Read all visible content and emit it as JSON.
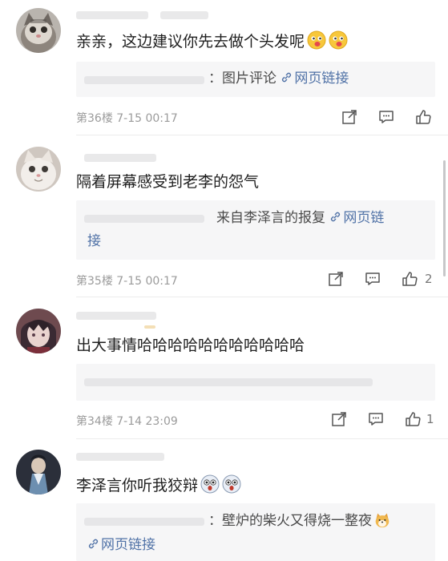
{
  "comments": [
    {
      "text": "亲亲，这边建议你先去做个头发呢",
      "quote": {
        "line1": "：图片评论",
        "link": "网页链接"
      },
      "meta": "第36楼 7-15 00:17",
      "likes": ""
    },
    {
      "text": "隔着屏幕感受到老李的怨气",
      "quote": {
        "line1": "来自李泽言的报复",
        "link_part1": "网页链",
        "link_part2": "接"
      },
      "meta": "第35楼 7-15 00:17",
      "likes": "2"
    },
    {
      "text": "出大事情哈哈哈哈哈哈哈哈哈哈哈",
      "meta": "第34楼 7-14 23:09",
      "likes": "1"
    },
    {
      "text": "李泽言你听我狡辩",
      "quote": {
        "line1": "：壁炉的柴火又得烧一整夜",
        "link": "网页链接"
      }
    }
  ],
  "icons": {
    "share": "share-icon",
    "reply": "comment-icon",
    "like": "thumbs-up-icon",
    "link": "link-icon"
  },
  "colors": {
    "link": "#4f71a6",
    "meta": "#9b9b9b",
    "quote_bg": "#f6f6f7"
  }
}
